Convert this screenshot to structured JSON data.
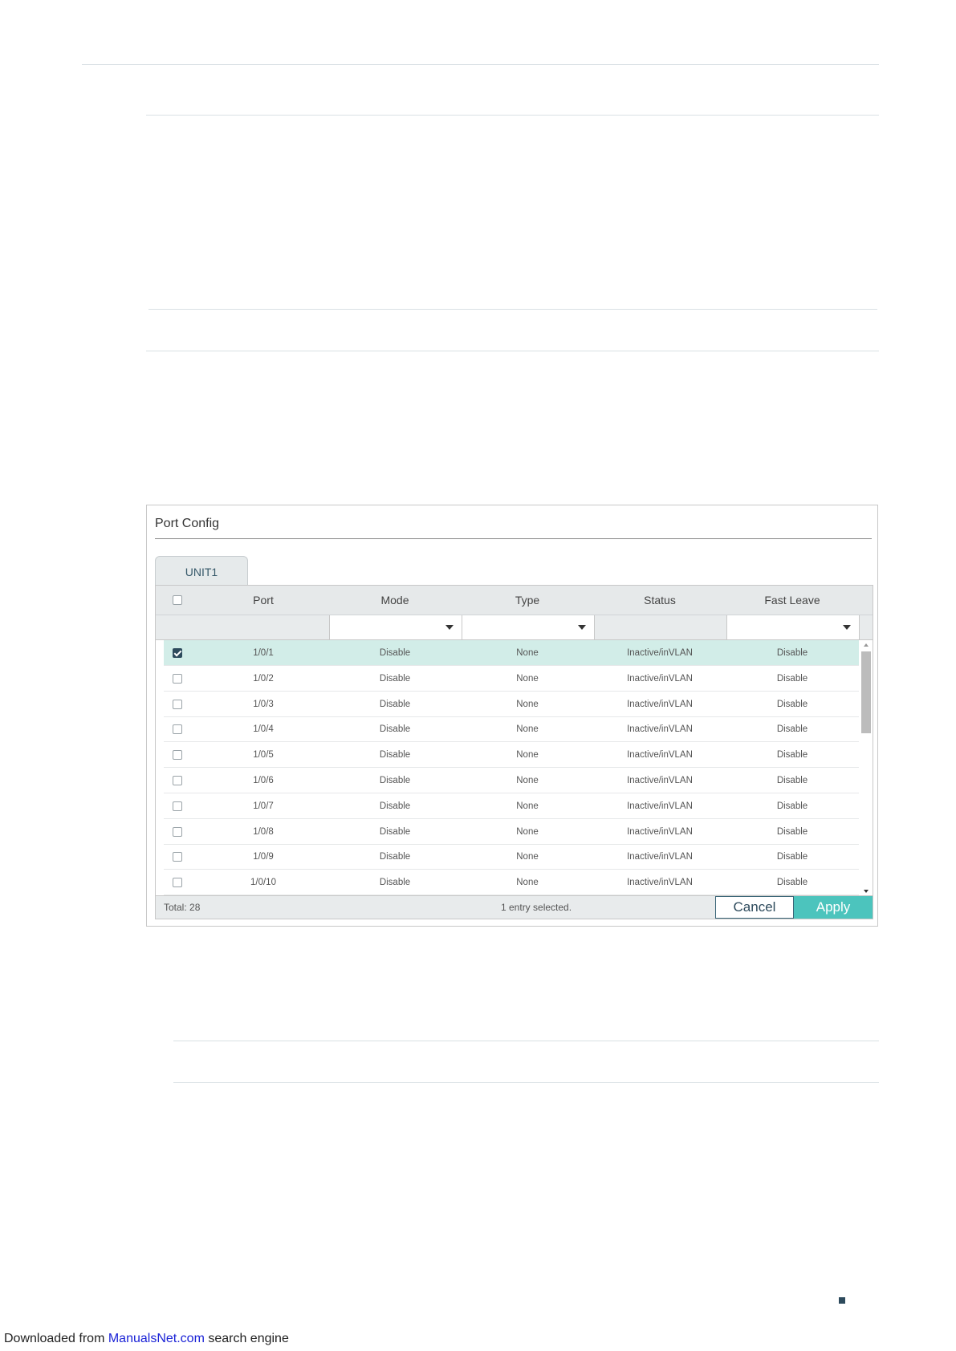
{
  "panel": {
    "title": "Port Config",
    "tab_label": "UNIT1",
    "columns": [
      "Port",
      "Mode",
      "Type",
      "Status",
      "Fast Leave"
    ],
    "rows": [
      {
        "port": "1/0/1",
        "mode": "Disable",
        "type": "None",
        "status": "Inactive/inVLAN",
        "fast_leave": "Disable",
        "checked": true
      },
      {
        "port": "1/0/2",
        "mode": "Disable",
        "type": "None",
        "status": "Inactive/inVLAN",
        "fast_leave": "Disable",
        "checked": false
      },
      {
        "port": "1/0/3",
        "mode": "Disable",
        "type": "None",
        "status": "Inactive/inVLAN",
        "fast_leave": "Disable",
        "checked": false
      },
      {
        "port": "1/0/4",
        "mode": "Disable",
        "type": "None",
        "status": "Inactive/inVLAN",
        "fast_leave": "Disable",
        "checked": false
      },
      {
        "port": "1/0/5",
        "mode": "Disable",
        "type": "None",
        "status": "Inactive/inVLAN",
        "fast_leave": "Disable",
        "checked": false
      },
      {
        "port": "1/0/6",
        "mode": "Disable",
        "type": "None",
        "status": "Inactive/inVLAN",
        "fast_leave": "Disable",
        "checked": false
      },
      {
        "port": "1/0/7",
        "mode": "Disable",
        "type": "None",
        "status": "Inactive/inVLAN",
        "fast_leave": "Disable",
        "checked": false
      },
      {
        "port": "1/0/8",
        "mode": "Disable",
        "type": "None",
        "status": "Inactive/inVLAN",
        "fast_leave": "Disable",
        "checked": false
      },
      {
        "port": "1/0/9",
        "mode": "Disable",
        "type": "None",
        "status": "Inactive/inVLAN",
        "fast_leave": "Disable",
        "checked": false
      },
      {
        "port": "1/0/10",
        "mode": "Disable",
        "type": "None",
        "status": "Inactive/inVLAN",
        "fast_leave": "Disable",
        "checked": false
      }
    ],
    "footer": {
      "total": "Total: 28",
      "selection": "1 entry selected.",
      "cancel_label": "Cancel",
      "apply_label": "Apply"
    }
  },
  "download_note": {
    "prefix": "Downloaded from ",
    "link": "ManualsNet.com",
    "suffix": " search engine"
  },
  "colors": {
    "accent": "#4cc4bd",
    "selected_row": "#d2ede8",
    "dark": "#2d4a5c"
  }
}
